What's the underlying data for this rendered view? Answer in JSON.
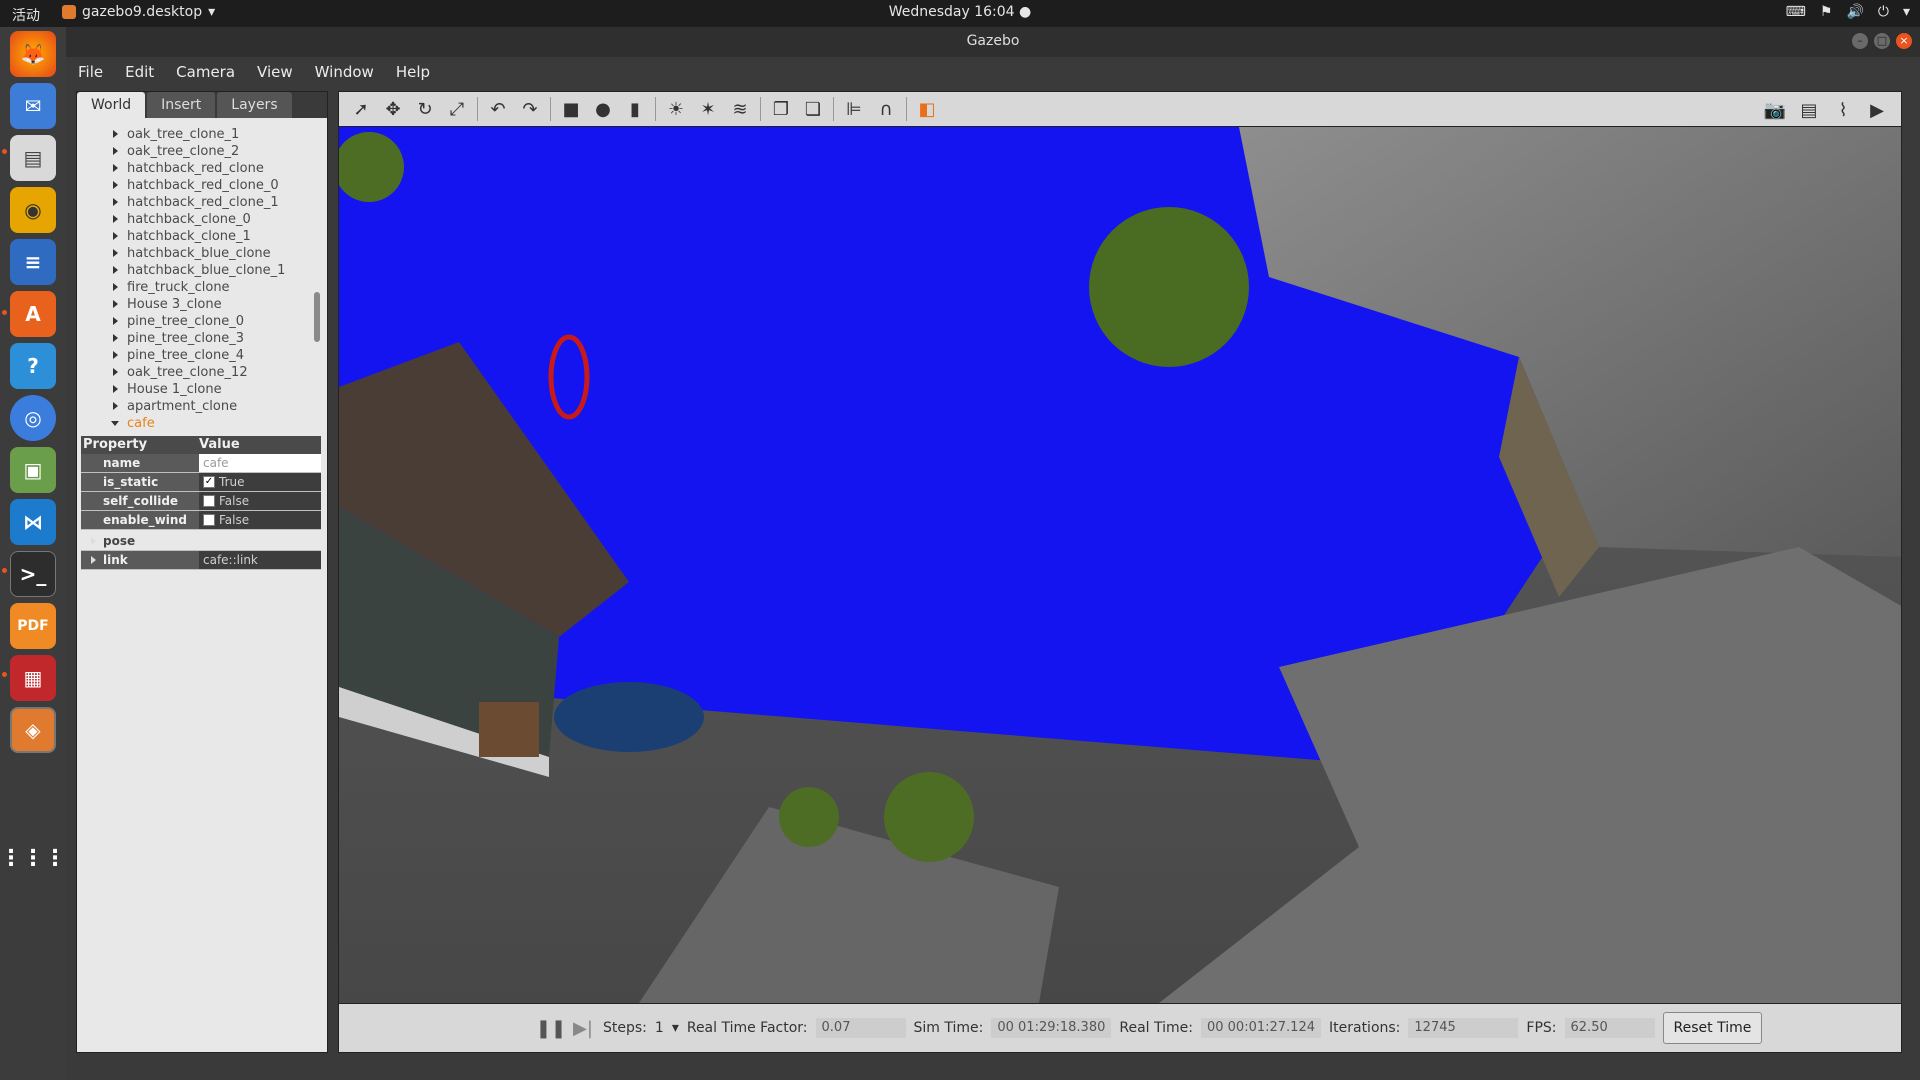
{
  "topbar": {
    "activities": "活动",
    "app_menu": "gazebo9.desktop",
    "clock": "Wednesday 16:04"
  },
  "window": {
    "title": "Gazebo"
  },
  "menu": [
    "File",
    "Edit",
    "Camera",
    "View",
    "Window",
    "Help"
  ],
  "left_panel": {
    "tabs": [
      "World",
      "Insert",
      "Layers"
    ],
    "active_tab": "World",
    "tree_items": [
      "oak_tree_clone_1",
      "oak_tree_clone_2",
      "hatchback_red_clone",
      "hatchback_red_clone_0",
      "hatchback_red_clone_1",
      "hatchback_clone_0",
      "hatchback_clone_1",
      "hatchback_blue_clone",
      "hatchback_blue_clone_1",
      "fire_truck_clone",
      "House 3_clone",
      "pine_tree_clone_0",
      "pine_tree_clone_3",
      "pine_tree_clone_4",
      "oak_tree_clone_12",
      "House 1_clone",
      "apartment_clone"
    ],
    "selected_item": "cafe",
    "properties": {
      "header_property": "Property",
      "header_value": "Value",
      "name_key": "name",
      "name_value": "cafe",
      "is_static_key": "is_static",
      "is_static_value": "True",
      "self_collide_key": "self_collide",
      "self_collide_value": "False",
      "enable_wind_key": "enable_wind",
      "enable_wind_value": "False",
      "pose_key": "pose",
      "link_key": "link",
      "link_value": "cafe::link"
    }
  },
  "bottom_bar": {
    "steps_label": "Steps:",
    "steps_value": "1",
    "rtf_label": "Real Time Factor:",
    "rtf_value": "0.07",
    "sim_time_label": "Sim Time:",
    "sim_time_value": "00 01:29:18.380",
    "real_time_label": "Real Time:",
    "real_time_value": "00 00:01:27.124",
    "iterations_label": "Iterations:",
    "iterations_value": "12745",
    "fps_label": "FPS:",
    "fps_value": "62.50",
    "reset_label": "Reset Time"
  },
  "colors": {
    "laser": "#1414f0",
    "selected": "#e8831a",
    "ubuntu_orange": "#e95420"
  }
}
